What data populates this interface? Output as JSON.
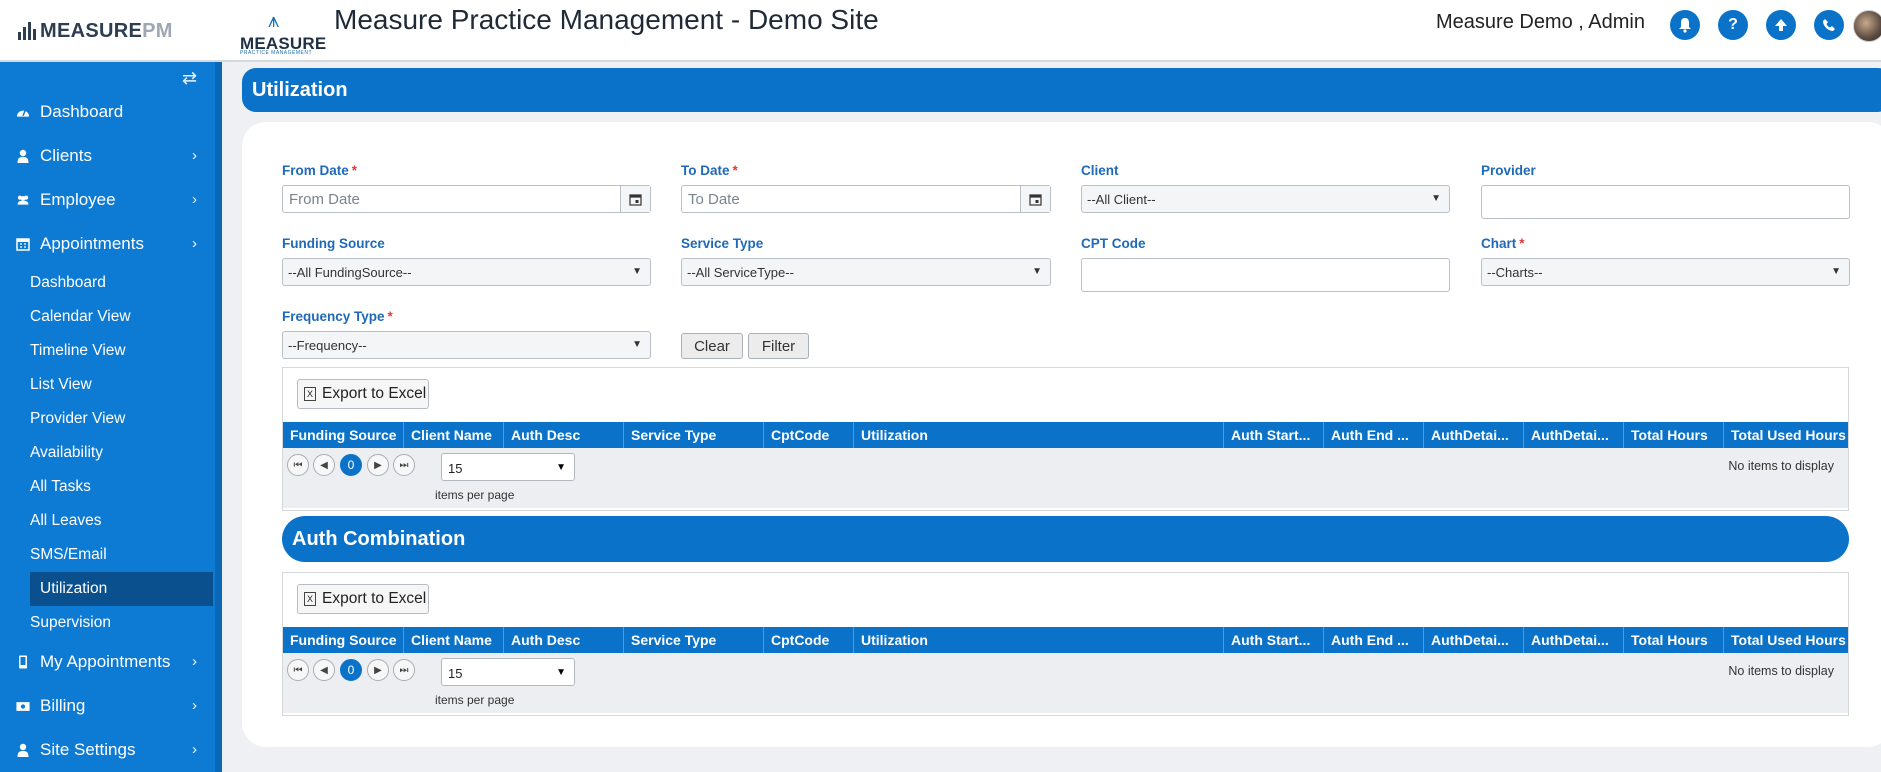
{
  "header": {
    "brand": "MEASURE",
    "brand_suffix": "PM",
    "logo_text": "MEASURE",
    "logo_sub": "PRACTICE MANAGEMENT",
    "site_title": "Measure Practice Management - Demo Site",
    "user": "Measure Demo , Admin",
    "icons": [
      "bell-icon",
      "help-icon",
      "upload-icon",
      "phone-icon"
    ]
  },
  "sidebar": {
    "items": [
      {
        "label": "Dashboard",
        "icon": "dashboard-icon"
      },
      {
        "label": "Clients",
        "icon": "user-icon"
      },
      {
        "label": "Employee",
        "icon": "users-icon"
      },
      {
        "label": "Appointments",
        "icon": "calendar-icon"
      }
    ],
    "subitems": [
      "Dashboard",
      "Calendar View",
      "Timeline View",
      "List View",
      "Provider View",
      "Availability",
      "All Tasks",
      "All Leaves",
      "SMS/Email",
      "Utilization",
      "Supervision"
    ],
    "active_subitem": "Utilization",
    "bottom_items": [
      {
        "label": "My Appointments",
        "icon": "mobile-icon"
      },
      {
        "label": "Billing",
        "icon": "money-icon"
      },
      {
        "label": "Site Settings",
        "icon": "user-icon"
      }
    ]
  },
  "page": {
    "title": "Utilization"
  },
  "filters": {
    "from_date_label": "From Date",
    "from_date_placeholder": "From Date",
    "to_date_label": "To Date",
    "to_date_placeholder": "To Date",
    "client_label": "Client",
    "client_value": "--All Client--",
    "provider_label": "Provider",
    "funding_label": "Funding Source",
    "funding_value": "--All FundingSource--",
    "service_label": "Service Type",
    "service_value": "--All ServiceType--",
    "cpt_label": "CPT Code",
    "chart_label": "Chart",
    "chart_value": "--Charts--",
    "frequency_label": "Frequency Type",
    "frequency_value": "--Frequency--",
    "clear": "Clear",
    "filter": "Filter"
  },
  "grid": {
    "export": "Export to Excel",
    "columns": [
      "Funding Source",
      "Client Name",
      "Auth Desc",
      "Service Type",
      "CptCode",
      "Utilization",
      "Auth Start...",
      "Auth End ...",
      "AuthDetai...",
      "AuthDetai...",
      "Total Hours",
      "Total Used Hours"
    ],
    "page": "0",
    "page_size": "15",
    "items_per_page": "items per page",
    "empty": "No items to display"
  },
  "auth_section": {
    "title": "Auth Combination"
  },
  "colors": {
    "primary": "#0a73c9",
    "sidebar": "#0d7ad3",
    "active": "#0a4f8e",
    "required": "#e03b3b"
  }
}
